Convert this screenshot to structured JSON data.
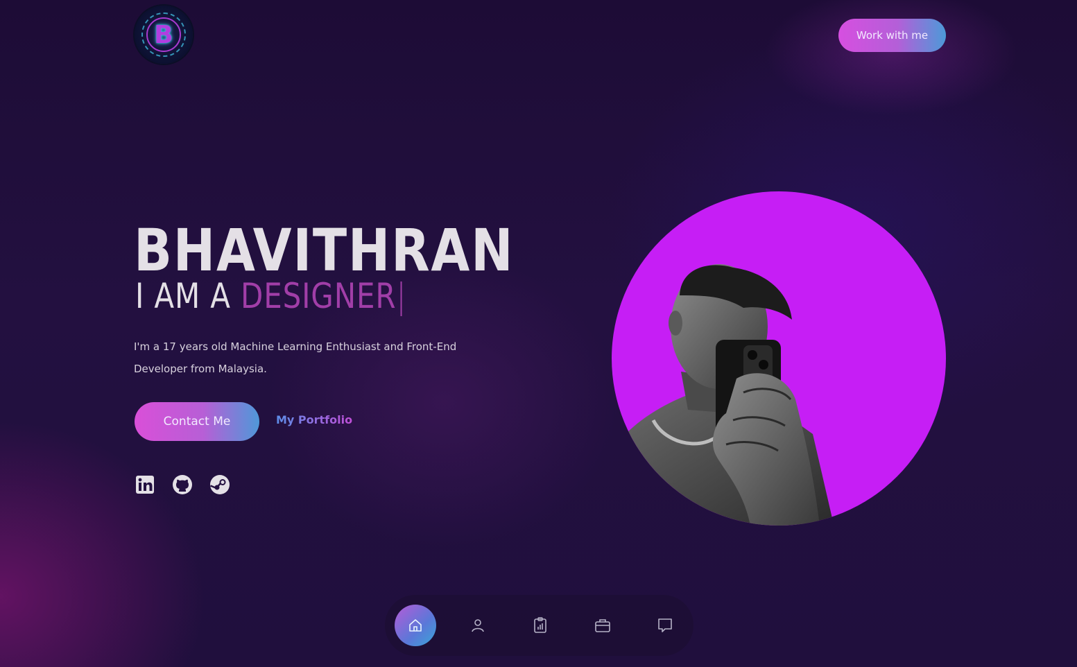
{
  "header": {
    "logo_letter": "B",
    "cta_label": "Work with me"
  },
  "hero": {
    "name": "BHAVITHRAN",
    "role_prefix": "I AM A ",
    "role_typed": "DESIGNER",
    "role_cursor": "|",
    "bio": "I'm a 17 years old Machine Learning Enthusiast and Front-End Developer from Malaysia.",
    "contact_label": "Contact Me",
    "portfolio_label": "My Portfolio"
  },
  "socials": [
    {
      "icon": "linkedin-icon"
    },
    {
      "icon": "github-icon"
    },
    {
      "icon": "steam-icon"
    }
  ],
  "portrait": {
    "background_color": "#c61ef5"
  },
  "bottom_nav": {
    "items": [
      {
        "icon": "home-icon",
        "active": true
      },
      {
        "icon": "user-icon",
        "active": false
      },
      {
        "icon": "clipboard-chart-icon",
        "active": false
      },
      {
        "icon": "briefcase-icon",
        "active": false
      },
      {
        "icon": "chat-icon",
        "active": false
      }
    ]
  },
  "colors": {
    "accent_pink": "#d64fe0",
    "accent_blue": "#4c9ad8",
    "accent_purple_text": "#a13ea8",
    "background": "#1f0d3b"
  }
}
